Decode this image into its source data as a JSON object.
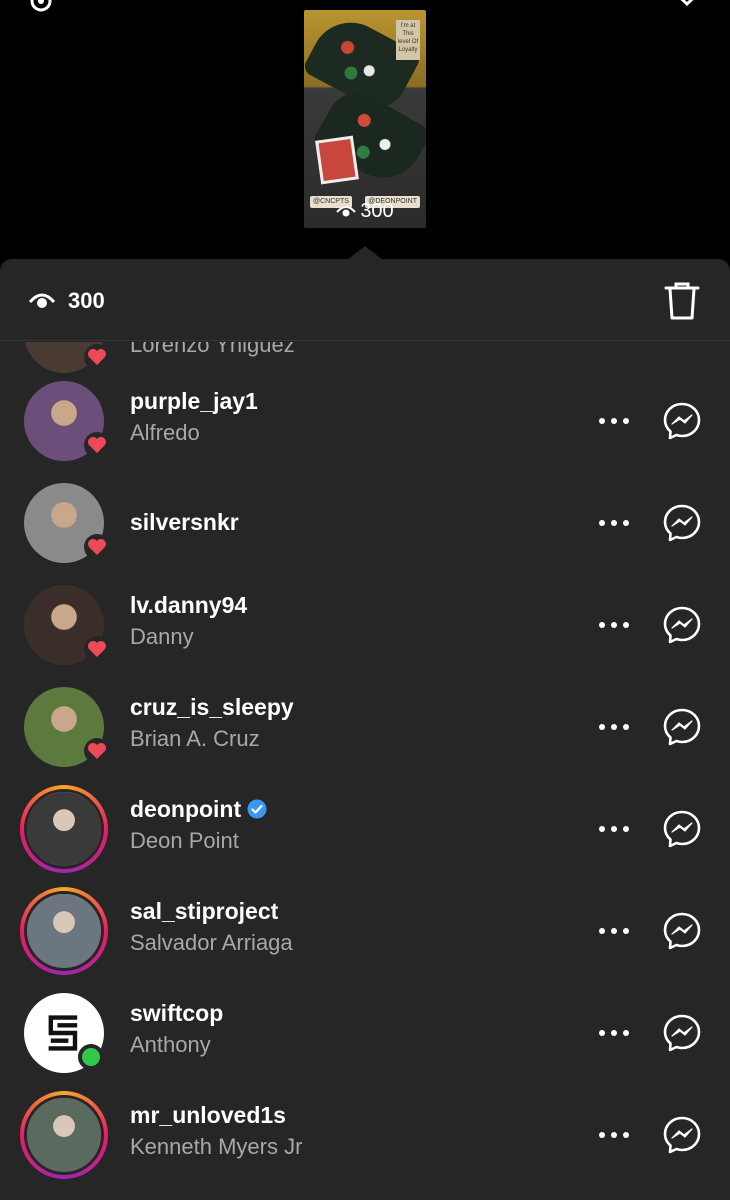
{
  "story": {
    "thumbnail_note": "I'm at This level Of Loyalty",
    "tag_left": "@CNCPTS",
    "tag_right": "@DEONPOINT",
    "view_count": "300"
  },
  "header": {
    "view_count": "300"
  },
  "viewers": [
    {
      "username": "",
      "full_name": "Lorenzo Yniguez",
      "liked": true,
      "verified": false,
      "story_ring": false,
      "online": false,
      "avatar_color": "#4a3a34"
    },
    {
      "username": "purple_jay1",
      "full_name": "Alfredo",
      "liked": true,
      "verified": false,
      "story_ring": false,
      "online": false,
      "avatar_color": "#6b4f7a"
    },
    {
      "username": "silversnkr",
      "full_name": "",
      "liked": true,
      "verified": false,
      "story_ring": false,
      "online": false,
      "avatar_color": "#8a8a8a"
    },
    {
      "username": "lv.danny94",
      "full_name": "Danny",
      "liked": true,
      "verified": false,
      "story_ring": false,
      "online": false,
      "avatar_color": "#3b2e2a"
    },
    {
      "username": "cruz_is_sleepy",
      "full_name": "Brian A. Cruz",
      "liked": true,
      "verified": false,
      "story_ring": false,
      "online": false,
      "avatar_color": "#5d7a3e"
    },
    {
      "username": "deonpoint",
      "full_name": "Deon Point",
      "liked": false,
      "verified": true,
      "story_ring": true,
      "online": false,
      "avatar_color": "#3a3a3a"
    },
    {
      "username": "sal_stiproject",
      "full_name": "Salvador Arriaga",
      "liked": false,
      "verified": false,
      "story_ring": true,
      "online": false,
      "avatar_color": "#6c7680"
    },
    {
      "username": "swiftcop",
      "full_name": "Anthony",
      "liked": false,
      "verified": false,
      "story_ring": false,
      "online": true,
      "avatar_color": "#ffffff"
    },
    {
      "username": "mr_unloved1s",
      "full_name": "Kenneth Myers Jr",
      "liked": false,
      "verified": false,
      "story_ring": true,
      "online": false,
      "avatar_color": "#5a6a5e"
    }
  ],
  "colors": {
    "background": "#000000",
    "sheet": "#262626",
    "heart": "#ed4956",
    "verified": "#3897f0",
    "online": "#31c84a",
    "secondary_text": "#a8a8a8"
  },
  "icons": {
    "settings": "gear-icon",
    "close": "close-icon",
    "views": "eye-icon",
    "delete": "trash-icon",
    "options": "more-icon",
    "message": "messenger-icon",
    "like": "heart-icon",
    "verified": "verified-badge-icon"
  }
}
